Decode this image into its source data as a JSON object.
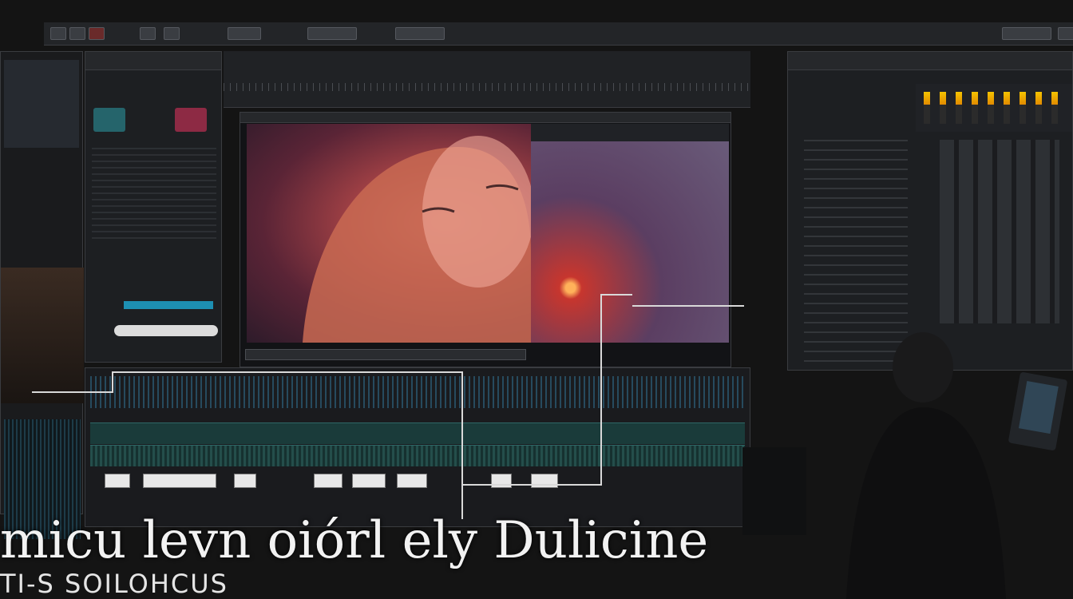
{
  "app": {
    "menu_labels": [
      "",
      "",
      "",
      "",
      "",
      "",
      ""
    ],
    "top_tabs": [
      "",
      "",
      "",
      ""
    ]
  },
  "left_panel": {
    "header": "",
    "rows": [
      "",
      "",
      "",
      "",
      "",
      "",
      "",
      ""
    ]
  },
  "media_pool": {
    "header": "",
    "items": [
      "",
      "",
      "",
      "",
      ""
    ]
  },
  "viewer": {
    "header": "",
    "timecode": "",
    "split_preview_label": ""
  },
  "timeline": {
    "tracks": [
      "",
      "",
      ""
    ],
    "clips": [
      "",
      "",
      "",
      "",
      "",
      "",
      "",
      ""
    ]
  },
  "mixer": {
    "header": "",
    "rows": [
      "",
      "",
      "",
      "",
      "",
      "",
      ""
    ]
  },
  "overlay": {
    "title": "micu levn oiórl ely Dulicine",
    "subtitle": "TI-S SOILOHCUS"
  },
  "colors": {
    "accent_cyan": "#2bb3c9",
    "accent_yellow": "#f5c400",
    "panel_bg": "#1d1f22",
    "track_teal": "#1a3b3a"
  },
  "icons": [
    "menu-icon",
    "play-icon",
    "record-icon",
    "settings-icon",
    "search-icon"
  ]
}
